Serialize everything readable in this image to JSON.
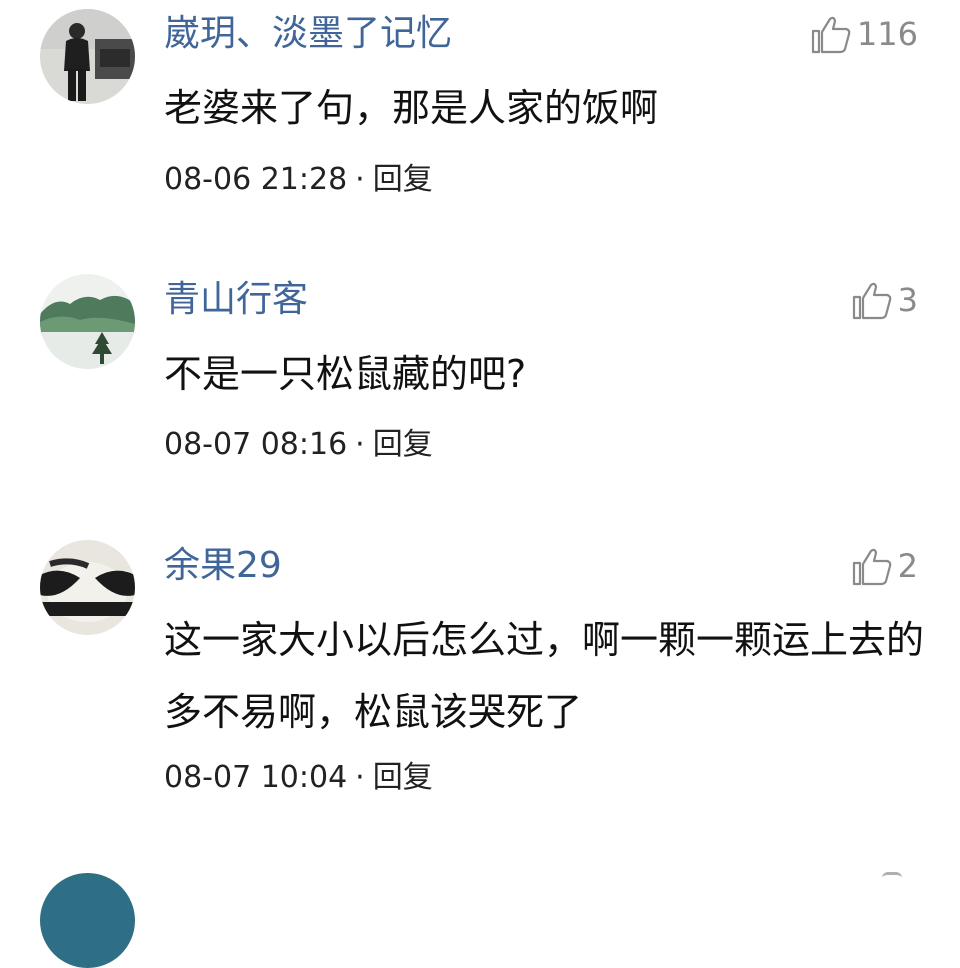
{
  "comments": [
    {
      "username": "崴玥、淡墨了记忆",
      "likes": "116",
      "text": "老婆来了句，那是人家的饭啊",
      "time": "08-06 21:28",
      "separator": "·",
      "reply": "回复"
    },
    {
      "username": "青山行客",
      "likes": "3",
      "text": "不是一只松鼠藏的吧?",
      "time": "08-07 08:16",
      "separator": "·",
      "reply": "回复"
    },
    {
      "username": "余果29",
      "likes": "2",
      "text": "这一家大小以后怎么过，啊一颗一颗运上去的多不易啊，松鼠该哭死了",
      "time": "08-07 10:04",
      "separator": "·",
      "reply": "回复"
    }
  ],
  "colors": {
    "username": "#406599",
    "like": "#8a8a8a",
    "text": "#111111",
    "meta": "#222222"
  },
  "icons": {
    "like": "thumbs-up-icon",
    "avatar_1": "person-photo-avatar",
    "avatar_2": "mountain-landscape-avatar",
    "avatar_3": "panda-avatar"
  }
}
